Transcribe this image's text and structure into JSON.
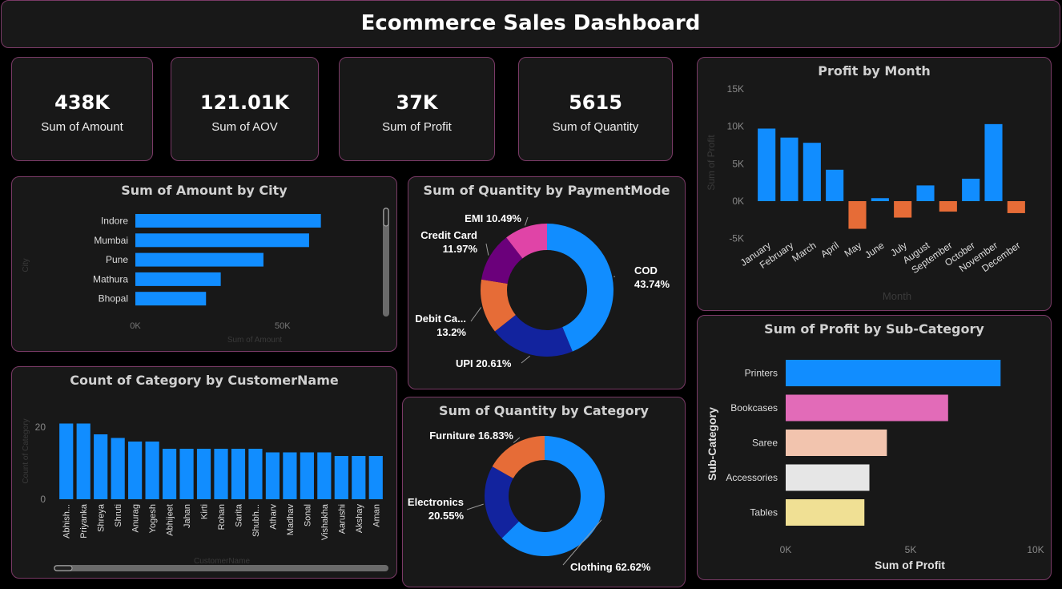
{
  "dashboard": {
    "title": "Ecommerce Sales Dashboard"
  },
  "kpis": [
    {
      "value": "438K",
      "label": "Sum of Amount"
    },
    {
      "value": "121.01K",
      "label": "Sum of AOV"
    },
    {
      "value": "37K",
      "label": "Sum of Profit"
    },
    {
      "value": "5615",
      "label": "Sum of Quantity"
    }
  ],
  "colors": {
    "accent": "#118DFF",
    "negative": "#E66C37",
    "panel": "#181818",
    "border": "#7a3a66"
  },
  "chart_data": [
    {
      "id": "amount_by_city",
      "type": "bar",
      "orientation": "horizontal",
      "title": "Sum of Amount by City",
      "xlabel": "Sum of Amount",
      "ylabel": "City",
      "categories": [
        "Indore",
        "Mumbai",
        "Pune",
        "Mathura",
        "Bhopal"
      ],
      "values": [
        63000,
        59000,
        43500,
        29000,
        24000
      ],
      "xlim": [
        0,
        65000
      ],
      "xticks": [
        {
          "v": 0,
          "label": "0K"
        },
        {
          "v": 50000,
          "label": "50K"
        }
      ]
    },
    {
      "id": "count_by_customer",
      "type": "bar",
      "title": "Count of Category by CustomerName",
      "xlabel": "CustomerName",
      "ylabel": "Count of Category",
      "categories": [
        "Abhish...",
        "Priyanka",
        "Shreya",
        "Shruti",
        "Anurag",
        "Yogesh",
        "Abhijeet",
        "Jahan",
        "Kirti",
        "Rohan",
        "Sarita",
        "Shubh...",
        "Atharv",
        "Madhav",
        "Sonal",
        "Vishakha",
        "Aarushi",
        "Akshay",
        "Aman"
      ],
      "values": [
        21,
        21,
        18,
        17,
        16,
        16,
        14,
        14,
        14,
        14,
        14,
        14,
        13,
        13,
        13,
        13,
        12,
        12,
        12
      ],
      "ylim": [
        0,
        22
      ],
      "yticks": [
        {
          "v": 0,
          "label": "0"
        },
        {
          "v": 20,
          "label": "20"
        }
      ]
    },
    {
      "id": "quantity_by_payment",
      "type": "pie",
      "title": "Sum of Quantity by PaymentMode",
      "slices": [
        {
          "label": "COD",
          "value": 43.74,
          "pct": "43.74%",
          "color": "#118DFF"
        },
        {
          "label": "UPI",
          "value": 20.61,
          "pct": "20.61%",
          "color": "#12239E"
        },
        {
          "label": "Debit Ca...",
          "value": 13.2,
          "pct": "13.2%",
          "color": "#E66C37"
        },
        {
          "label": "Credit Card",
          "value": 11.97,
          "pct": "11.97%",
          "color": "#6B007B"
        },
        {
          "label": "EMI",
          "value": 10.49,
          "pct": "10.49%",
          "color": "#E044A7"
        }
      ]
    },
    {
      "id": "quantity_by_category",
      "type": "pie",
      "title": "Sum of Quantity by Category",
      "slices": [
        {
          "label": "Clothing",
          "value": 62.62,
          "pct": "62.62%",
          "color": "#118DFF"
        },
        {
          "label": "Electronics",
          "value": 20.55,
          "pct": "20.55%",
          "color": "#12239E"
        },
        {
          "label": "Furniture",
          "value": 16.83,
          "pct": "16.83%",
          "color": "#E66C37"
        }
      ]
    },
    {
      "id": "profit_by_month",
      "type": "bar",
      "title": "Profit by Month",
      "xlabel": "Month",
      "ylabel": "Sum of Profit",
      "categories": [
        "January",
        "February",
        "March",
        "April",
        "May",
        "June",
        "July",
        "August",
        "September",
        "October",
        "November",
        "December"
      ],
      "values": [
        9700,
        8500,
        7800,
        4200,
        -3700,
        400,
        -2200,
        2100,
        -1400,
        3000,
        10300,
        -1600
      ],
      "ylim": [
        -5000,
        15000
      ],
      "yticks": [
        {
          "v": -5000,
          "label": "-5K"
        },
        {
          "v": 0,
          "label": "0K"
        },
        {
          "v": 5000,
          "label": "5K"
        },
        {
          "v": 10000,
          "label": "10K"
        },
        {
          "v": 15000,
          "label": "15K"
        }
      ]
    },
    {
      "id": "profit_by_subcategory",
      "type": "bar",
      "orientation": "horizontal",
      "title": "Sum of Profit by Sub-Category",
      "xlabel": "Sum of Profit",
      "ylabel": "Sub-Category",
      "categories": [
        "Printers",
        "Bookcases",
        "Saree",
        "Accessories",
        "Tables"
      ],
      "values": [
        8600,
        6500,
        4050,
        3350,
        3150
      ],
      "colors": [
        "#118DFF",
        "#E26BB8",
        "#F2C4AE",
        "#E6E6E6",
        "#F0E094"
      ],
      "xlim": [
        0,
        10000
      ],
      "xticks": [
        {
          "v": 0,
          "label": "0K"
        },
        {
          "v": 5000,
          "label": "5K"
        },
        {
          "v": 10000,
          "label": "10K"
        }
      ]
    }
  ]
}
